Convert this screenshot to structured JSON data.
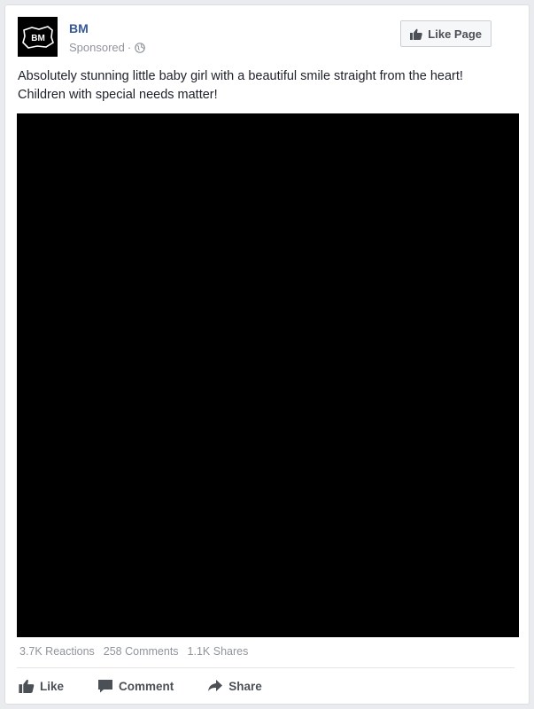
{
  "post": {
    "page_name": "BM",
    "avatar_text": "BM",
    "sponsored_label": "Sponsored",
    "separator": "·",
    "privacy_icon": "globe-icon",
    "like_page_label": "Like Page",
    "text": "Absolutely stunning little baby girl with a beautiful smile straight from the heart! Children with special needs matter!",
    "media_color": "#000000"
  },
  "stats": {
    "reactions": "3.7K Reactions",
    "comments": "258 Comments",
    "shares": "1.1K Shares"
  },
  "actions": {
    "like": "Like",
    "comment": "Comment",
    "share": "Share"
  },
  "colors": {
    "link_blue": "#365899",
    "meta_gray": "#90949c",
    "action_gray": "#4b4f56"
  }
}
